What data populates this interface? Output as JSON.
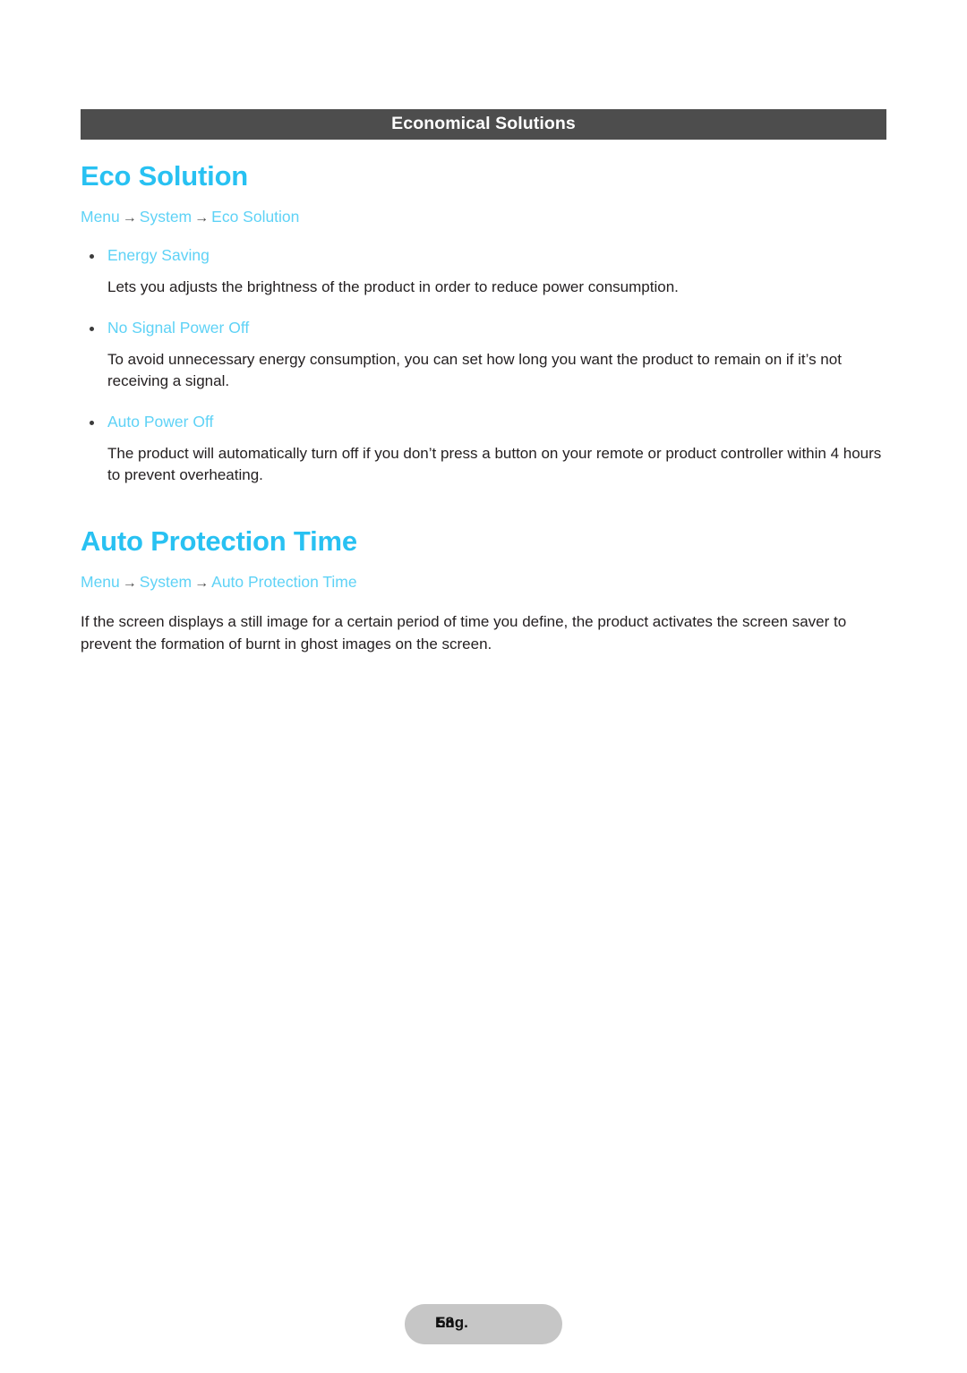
{
  "header": {
    "title": "Economical Solutions"
  },
  "sections": [
    {
      "title": "Eco Solution",
      "breadcrumb": {
        "items": [
          "Menu",
          "System",
          "Eco Solution"
        ],
        "separator": "→"
      },
      "bullets": [
        {
          "label": "Energy Saving",
          "body": "Lets you adjusts the brightness of the product in order to reduce power consumption."
        },
        {
          "label": "No Signal Power Off",
          "body": "To avoid unnecessary energy consumption, you can set how long you want the product to remain on if it’s not receiving a signal."
        },
        {
          "label": "Auto Power Off",
          "body": "The product will automatically turn off if you don’t press a button on your remote or product controller within 4 hours to prevent overheating."
        }
      ]
    },
    {
      "title": "Auto Protection Time",
      "breadcrumb": {
        "items": [
          "Menu",
          "System",
          "Auto Protection Time"
        ],
        "separator": "→"
      },
      "paragraph": "If the screen displays a still image for a certain period of time you define, the product activates the screen saver to prevent the formation of burnt in ghost images on the screen."
    }
  ],
  "footer": {
    "label": "Eng.",
    "page_number": "58"
  },
  "colors": {
    "accent_heading": "#28c1f2",
    "accent_link": "#5ed2f6",
    "header_bar": "#4d4d4d",
    "body_text": "#231f20",
    "footer_pill": "#c6c6c6"
  }
}
